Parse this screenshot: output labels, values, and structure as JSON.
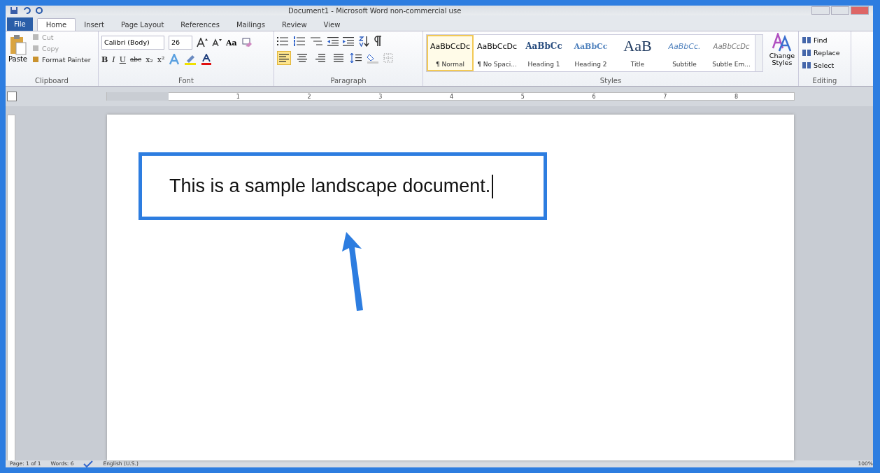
{
  "window": {
    "title": "Document1 - Microsoft Word non-commercial use"
  },
  "tabs": [
    {
      "label": "File",
      "kind": "file",
      "selected": false
    },
    {
      "label": "Home",
      "kind": "tab",
      "selected": true
    },
    {
      "label": "Insert",
      "kind": "tab",
      "selected": false
    },
    {
      "label": "Page Layout",
      "kind": "tab",
      "selected": false
    },
    {
      "label": "References",
      "kind": "tab",
      "selected": false
    },
    {
      "label": "Mailings",
      "kind": "tab",
      "selected": false
    },
    {
      "label": "Review",
      "kind": "tab",
      "selected": false
    },
    {
      "label": "View",
      "kind": "tab",
      "selected": false
    }
  ],
  "clipboard": {
    "label": "Clipboard",
    "paste": "Paste",
    "items": [
      {
        "label": "Cut",
        "disabled": true
      },
      {
        "label": "Copy",
        "disabled": true
      },
      {
        "label": "Format Painter",
        "disabled": false
      }
    ]
  },
  "font": {
    "label": "Font",
    "family": "Calibri (Body)",
    "size": "26",
    "case_button": "Aa",
    "format_buttons": [
      "B",
      "I",
      "U",
      "abc",
      "x₂",
      "x²"
    ]
  },
  "paragraph": {
    "label": "Paragraph",
    "align_buttons": [
      {
        "selected": true
      },
      {
        "selected": false
      },
      {
        "selected": false
      },
      {
        "selected": false
      }
    ]
  },
  "styles": {
    "label": "Styles",
    "change_styles": "Change Styles",
    "items": [
      {
        "preview": "AaBbCcDc",
        "name": "¶ Normal",
        "kind": "normal",
        "selected": true
      },
      {
        "preview": "AaBbCcDc",
        "name": "¶ No Spaci...",
        "kind": "normal",
        "selected": false
      },
      {
        "preview": "AaBbCc",
        "name": "Heading 1",
        "kind": "heading1",
        "selected": false
      },
      {
        "preview": "AaBbCc",
        "name": "Heading 2",
        "kind": "heading2",
        "selected": false
      },
      {
        "preview": "AaB",
        "name": "Title",
        "kind": "title",
        "selected": false
      },
      {
        "preview": "AaBbCc.",
        "name": "Subtitle",
        "kind": "subtitle",
        "selected": false
      },
      {
        "preview": "AaBbCcDc",
        "name": "Subtle Em...",
        "kind": "subtle",
        "selected": false
      }
    ]
  },
  "editing": {
    "label": "Editing",
    "items": [
      "Find",
      "Replace",
      "Select"
    ]
  },
  "ruler": {
    "numbers": [
      "1",
      "2",
      "3",
      "4",
      "5",
      "6",
      "7",
      "8"
    ]
  },
  "document": {
    "text": "This is a sample landscape document."
  },
  "status_bar": {
    "page": "Page: 1 of 1",
    "words": "Words: 6",
    "language": "English (U.S.)",
    "zoom": "100%"
  }
}
